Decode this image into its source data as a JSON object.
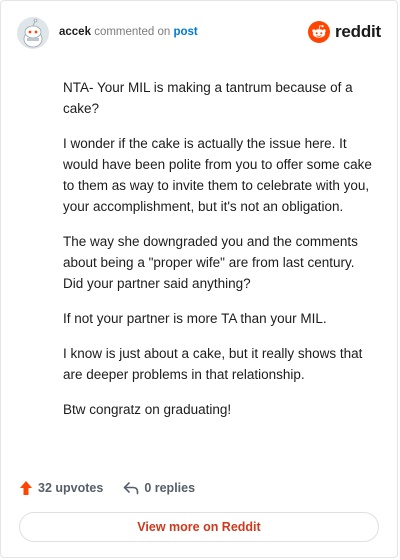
{
  "header": {
    "username": "accek",
    "commented_text": "commented on",
    "post_link": "post",
    "brand": "reddit"
  },
  "comment": {
    "paragraphs": [
      "NTA- Your MIL is making a tantrum because of a cake?",
      "I wonder if the cake is actually the issue here. It would have been polite from you to offer some cake to them as way to invite them to celebrate with you, your accomplishment, but it's not an obligation.",
      "The way she downgraded you and the comments about being a \"proper wife\" are from last century. Did your partner said anything?",
      "If not your partner is more TA than your MIL.",
      "I know is just about a cake, but it really shows that are deeper problems in that relationship.",
      "Btw congratz on graduating!"
    ]
  },
  "footer": {
    "upvotes": "32 upvotes",
    "replies": "0 replies",
    "view_more": "View more on Reddit"
  },
  "colors": {
    "accent": "#ff4500",
    "link": "#0079d3",
    "view_more": "#cc3a1e"
  },
  "icons": {
    "avatar": "snoo-avatar-icon",
    "brand": "reddit-logo-icon",
    "upvote": "upvote-arrow-icon",
    "reply": "reply-arrow-icon"
  }
}
